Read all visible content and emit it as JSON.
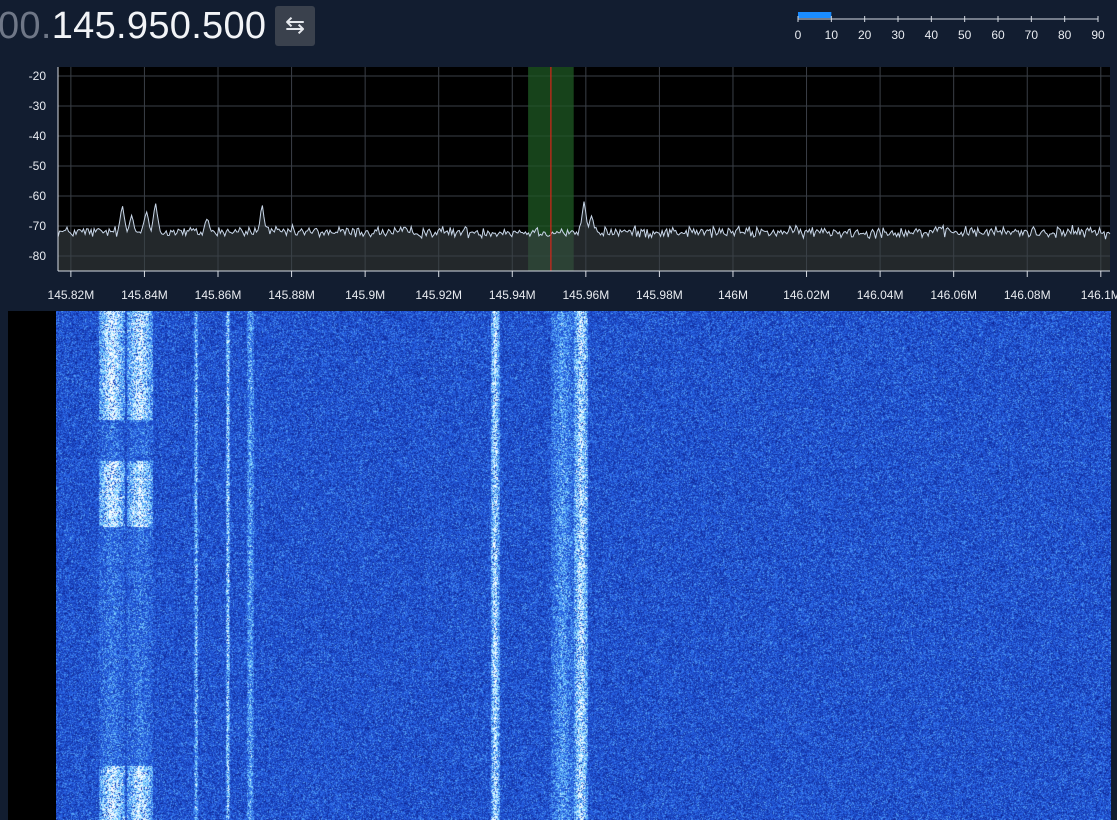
{
  "header": {
    "frequency_dim": "00.",
    "frequency_main": "145.950.500",
    "swap_icon": "swap-arrows-icon",
    "swap_glyph": "⇆"
  },
  "smeter": {
    "value": 10,
    "max": 90,
    "bar_color": "#1a8cff",
    "ticks": [
      "0",
      "10",
      "20",
      "30",
      "40",
      "50",
      "60",
      "70",
      "80",
      "90"
    ]
  },
  "spectrum": {
    "y_ticks": [
      "-20",
      "-30",
      "-40",
      "-50",
      "-60",
      "-70",
      "-80"
    ],
    "y_values": [
      -20,
      -30,
      -40,
      -50,
      -60,
      -70,
      -80
    ],
    "y_range": [
      -85,
      -17
    ],
    "x_ticks": [
      "145.82M",
      "145.84M",
      "145.86M",
      "145.88M",
      "145.9M",
      "145.92M",
      "145.94M",
      "145.96M",
      "145.98M",
      "146M",
      "146.02M",
      "146.04M",
      "146.06M",
      "146.08M",
      "146.1M"
    ],
    "x_values": [
      145.82,
      145.84,
      145.86,
      145.88,
      145.9,
      145.92,
      145.94,
      145.96,
      145.98,
      146.0,
      146.02,
      146.04,
      146.06,
      146.08,
      146.1
    ],
    "x_range": [
      145.8165,
      146.1025
    ],
    "center_freq": 145.9505,
    "filter_low": 145.9443,
    "filter_high": 145.9567,
    "noise_floor": -72,
    "peaks": [
      {
        "f": 145.834,
        "level": -63
      },
      {
        "f": 145.8365,
        "level": -66
      },
      {
        "f": 145.8405,
        "level": -65
      },
      {
        "f": 145.843,
        "level": -62
      },
      {
        "f": 145.857,
        "level": -67
      },
      {
        "f": 145.872,
        "level": -63
      },
      {
        "f": 145.9595,
        "level": -62
      },
      {
        "f": 145.9615,
        "level": -66
      }
    ],
    "trace_color": "#c8d6e8",
    "filter_color": "#1f5a24",
    "center_line_color": "#d8261a"
  },
  "waterfall": {
    "signals": [
      {
        "f": 145.835,
        "width": 0.0035,
        "strength": 0.95
      },
      {
        "f": 145.8425,
        "width": 0.0035,
        "strength": 0.9
      },
      {
        "f": 145.8575,
        "width": 0.0005,
        "strength": 0.6
      },
      {
        "f": 145.866,
        "width": 0.0005,
        "strength": 0.75
      },
      {
        "f": 145.872,
        "width": 0.001,
        "strength": 0.45
      },
      {
        "f": 145.9375,
        "width": 0.0012,
        "strength": 0.85
      },
      {
        "f": 145.9555,
        "width": 0.003,
        "strength": 0.4
      },
      {
        "f": 145.9605,
        "width": 0.002,
        "strength": 0.85
      }
    ]
  }
}
